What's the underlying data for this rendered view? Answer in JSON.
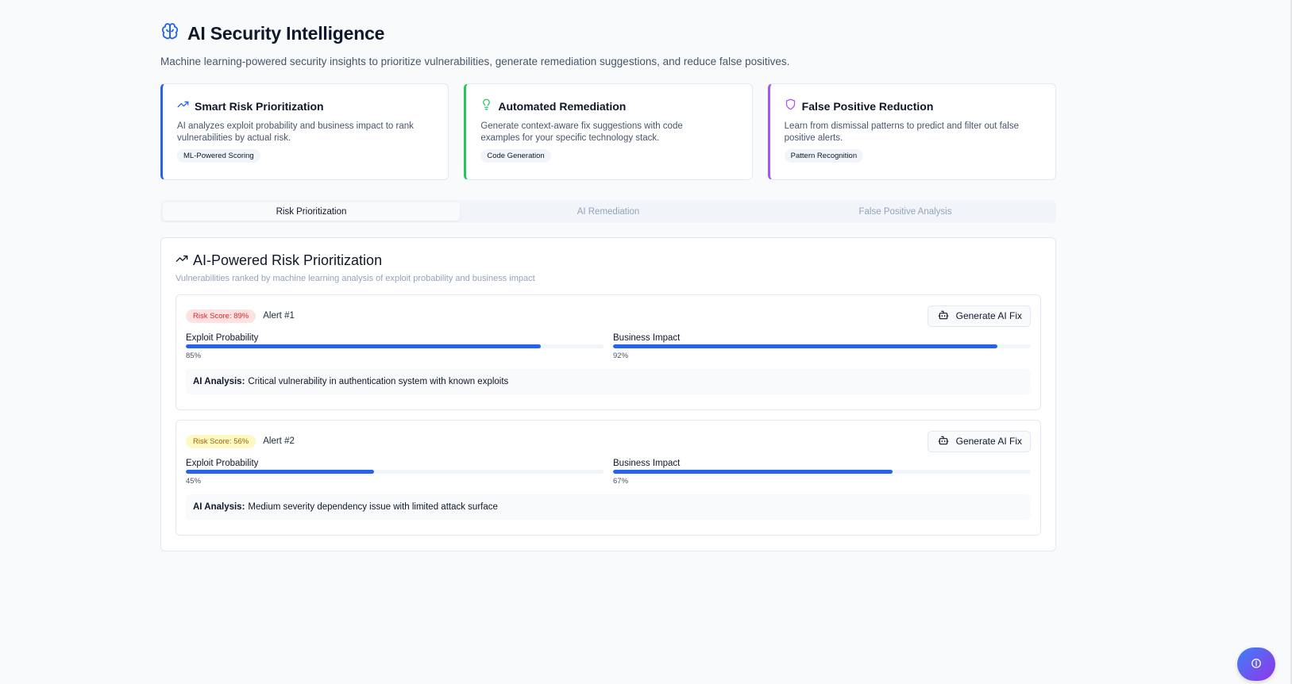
{
  "header": {
    "title": "AI Security Intelligence",
    "subtitle": "Machine learning-powered security insights to prioritize vulnerabilities, generate remediation suggestions, and reduce false positives.",
    "icon": "brain-icon"
  },
  "feature_cards": [
    {
      "title": "Smart Risk Prioritization",
      "description": "AI analyzes exploit probability and business impact to rank vulnerabilities by actual risk.",
      "badge": "ML-Powered Scoring",
      "icon": "trending-up-icon",
      "accent": "#2563eb"
    },
    {
      "title": "Automated Remediation",
      "description": "Generate context-aware fix suggestions with code examples for your specific technology stack.",
      "badge": "Code Generation",
      "icon": "lightbulb-icon",
      "accent": "#22c55e"
    },
    {
      "title": "False Positive Reduction",
      "description": "Learn from dismissal patterns to predict and filter out false positive alerts.",
      "badge": "Pattern Recognition",
      "icon": "shield-icon",
      "accent": "#a855f7"
    }
  ],
  "tabs": [
    {
      "label": "Risk Prioritization",
      "active": true
    },
    {
      "label": "AI Remediation",
      "active": false
    },
    {
      "label": "False Positive Analysis",
      "active": false
    }
  ],
  "panel": {
    "title": "AI-Powered Risk Prioritization",
    "subtitle": "Vulnerabilities ranked by machine learning analysis of exploit probability and business impact",
    "analysis_label": "AI Analysis:",
    "fix_button_label": "Generate AI Fix",
    "exploit_label": "Exploit Probability",
    "impact_label": "Business Impact"
  },
  "alerts": [
    {
      "risk_badge": "Risk Score: 89%",
      "severity": "high",
      "id_label": "Alert #1",
      "exploit_probability": 85,
      "exploit_text": "85%",
      "business_impact": 92,
      "impact_text": "92%",
      "analysis": "Critical vulnerability in authentication system with known exploits"
    },
    {
      "risk_badge": "Risk Score: 56%",
      "severity": "medium",
      "id_label": "Alert #2",
      "exploit_probability": 45,
      "exploit_text": "45%",
      "business_impact": 67,
      "impact_text": "67%",
      "analysis": "Medium severity dependency issue with limited attack surface"
    }
  ],
  "floating_button": {
    "icon": "info-icon"
  }
}
